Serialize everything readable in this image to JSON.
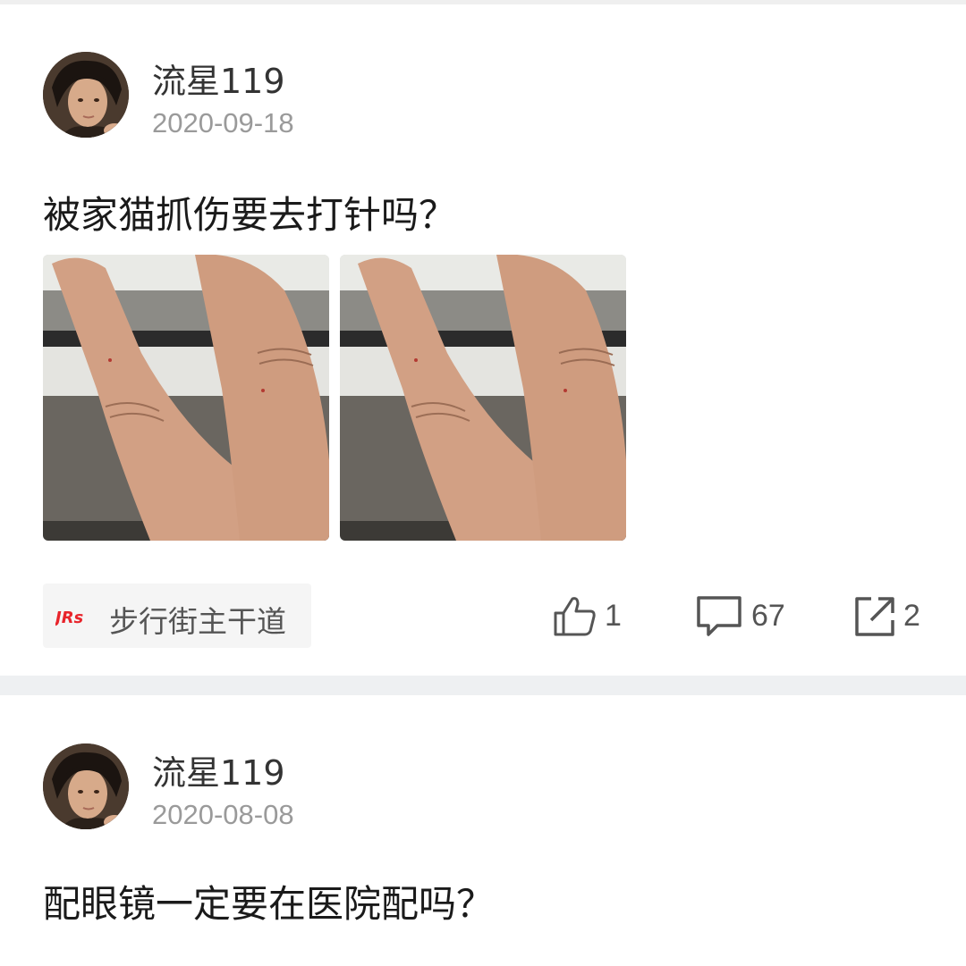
{
  "posts": [
    {
      "author": "流星119",
      "date": "2020-09-18",
      "title": "被家猫抓伤要去打针吗？",
      "images": [
        "finger-photo",
        "finger-photo"
      ],
      "board": {
        "logo_text": "JRs",
        "name": "步行街主干道"
      },
      "stats": {
        "likes": "1",
        "comments": "67",
        "shares": "2"
      }
    },
    {
      "author": "流星119",
      "date": "2020-08-08",
      "title": "配眼镜一定要在医院配吗？"
    }
  ],
  "icons": {
    "like": "thumbs-up-icon",
    "comment": "comment-icon",
    "share": "share-icon"
  },
  "colors": {
    "text_primary": "#1a1a1a",
    "text_secondary": "#9a9a9a",
    "icon": "#555555",
    "logo_red": "#e8242b",
    "separator": "#eef0f2"
  }
}
